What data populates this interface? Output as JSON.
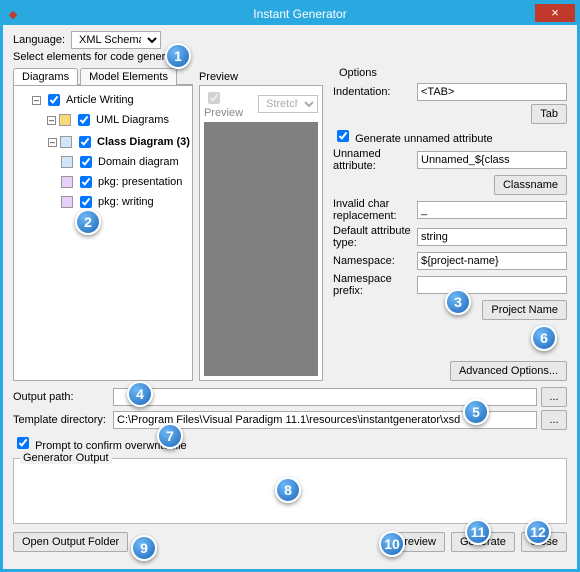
{
  "window": {
    "title": "Instant Generator",
    "close_glyph": "×",
    "app_icon": "◆"
  },
  "language": {
    "label": "Language:",
    "value": "XML Schema"
  },
  "select_label": "Select elements for code generation",
  "tabs": {
    "diagrams": "Diagrams",
    "model_elements": "Model Elements"
  },
  "tree": {
    "article_writing": "Article Writing",
    "uml_diagrams": "UML Diagrams",
    "class_diagram": "Class Diagram (3)",
    "domain_diagram": "Domain diagram",
    "pkg_presentation": "pkg: presentation",
    "pkg_writing": "pkg: writing"
  },
  "preview": {
    "title": "Preview",
    "checkbox": "Preview",
    "stretch": "Stretch"
  },
  "options": {
    "title": "Options",
    "indentation_label": "Indentation:",
    "indentation_value": "<TAB>",
    "tab_btn": "Tab",
    "gen_unnamed": "Generate unnamed attribute",
    "unnamed_attr_label": "Unnamed attribute:",
    "unnamed_attr_value": "Unnamed_${class",
    "classname_btn": "Classname",
    "invalid_label": "Invalid char replacement:",
    "invalid_value": "_",
    "def_attr_label": "Default attribute type:",
    "def_attr_value": "string",
    "namespace_label": "Namespace:",
    "namespace_value": "${project-name}",
    "nsprefix_label": "Namespace prefix:",
    "nsprefix_value": "",
    "project_name_btn": "Project Name",
    "advanced_btn": "Advanced Options..."
  },
  "paths": {
    "output_label": "Output path:",
    "output_value": "",
    "template_label": "Template directory:",
    "template_value": "C:\\Program Files\\Visual Paradigm 11.1\\resources\\instantgenerator\\xsd",
    "browse": "..."
  },
  "prompt_overwrite": "Prompt to confirm overwrite file",
  "generator_output": "Generator Output",
  "buttons": {
    "open_output": "Open Output Folder",
    "preview": "Preview",
    "generate": "Generate",
    "close": "Close"
  },
  "badges": [
    "1",
    "2",
    "3",
    "4",
    "5",
    "6",
    "7",
    "8",
    "9",
    "10",
    "11",
    "12"
  ]
}
